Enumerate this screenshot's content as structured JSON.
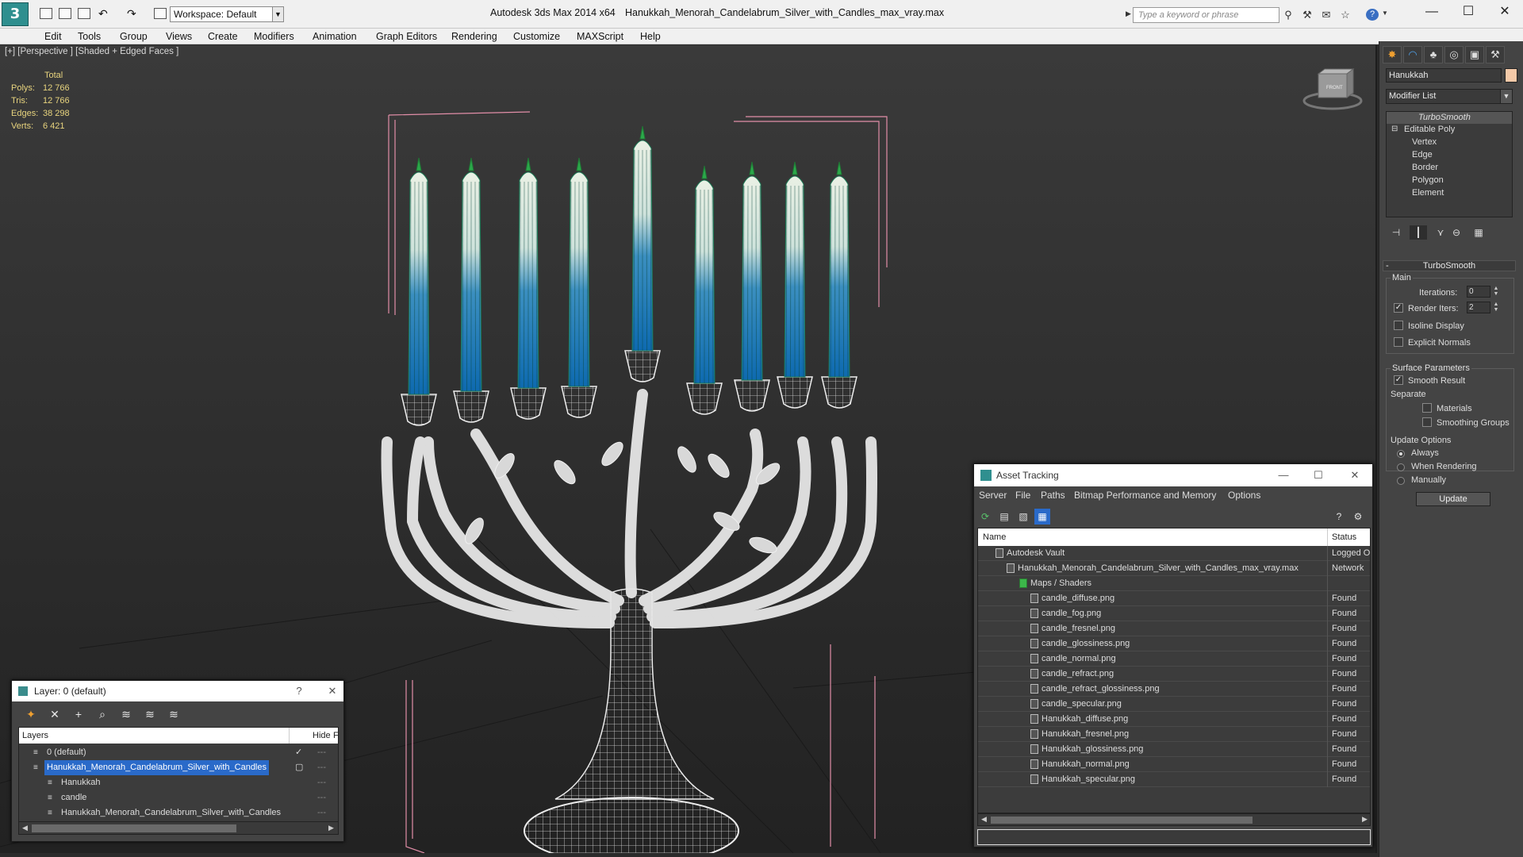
{
  "app": {
    "title": "Autodesk 3ds Max  2014 x64",
    "filename": "Hanukkah_Menorah_Candelabrum_Silver_with_Candles_max_vray.max",
    "workspace": "Workspace: Default",
    "search_placeholder": "Type a keyword or phrase",
    "logo_letter": "3"
  },
  "menu": [
    "Edit",
    "Tools",
    "Group",
    "Views",
    "Create",
    "Modifiers",
    "Animation",
    "Graph Editors",
    "Rendering",
    "Customize",
    "MAXScript",
    "Help"
  ],
  "viewport": {
    "label": "[+] [Perspective ] [Shaded + Edged Faces ]",
    "stats_header": "Total",
    "stats": [
      {
        "label": "Polys:",
        "value": "12 766"
      },
      {
        "label": "Tris:",
        "value": "12 766"
      },
      {
        "label": "Edges:",
        "value": "38 298"
      },
      {
        "label": "Verts:",
        "value": "6 421"
      }
    ],
    "viewcube_label": "FRONT"
  },
  "command_panel": {
    "object_name": "Hanukkah",
    "object_color": "#f3c9a8",
    "modifier_list": "Modifier List",
    "stack": {
      "top": "TurboSmooth",
      "base": "Editable Poly",
      "subs": [
        "Vertex",
        "Edge",
        "Border",
        "Polygon",
        "Element"
      ]
    },
    "turbosmooth": {
      "header": "TurboSmooth",
      "main_group": "Main",
      "iterations_label": "Iterations:",
      "iterations": "0",
      "render_iters_label": "Render Iters:",
      "render_iters": "2",
      "render_iters_checked": true,
      "isoline": "Isoline Display",
      "explicit_normals": "Explicit Normals",
      "surface_group": "Surface Parameters",
      "smooth_result": "Smooth Result",
      "smooth_result_checked": true,
      "separate_label": "Separate",
      "materials": "Materials",
      "smoothing_groups": "Smoothing Groups",
      "update_group": "Update Options",
      "always": "Always",
      "when_rendering": "When Rendering",
      "manually": "Manually",
      "update_button": "Update"
    }
  },
  "layer_dialog": {
    "title": "Layer: 0 (default)",
    "help": "?",
    "close": "✕",
    "col_layers": "Layers",
    "col_hide": "Hide",
    "col_extra": "F",
    "rows": [
      {
        "name": "0 (default)",
        "indent": 1,
        "selected": false,
        "check": "✓"
      },
      {
        "name": "Hanukkah_Menorah_Candelabrum_Silver_with_Candles",
        "indent": 1,
        "selected": true,
        "check": "▢"
      },
      {
        "name": "Hanukkah",
        "indent": 2,
        "selected": false,
        "check": ""
      },
      {
        "name": "candle",
        "indent": 2,
        "selected": false,
        "check": ""
      },
      {
        "name": "Hanukkah_Menorah_Candelabrum_Silver_with_Candles",
        "indent": 2,
        "selected": false,
        "check": ""
      }
    ]
  },
  "asset_dialog": {
    "title": "Asset Tracking",
    "menu": [
      "Server",
      "File",
      "Paths",
      "Bitmap Performance and Memory",
      "Options"
    ],
    "col_name": "Name",
    "col_status": "Status",
    "rows": [
      {
        "name": "Autodesk Vault",
        "status": "Logged O",
        "indent": 1
      },
      {
        "name": "Hanukkah_Menorah_Candelabrum_Silver_with_Candles_max_vray.max",
        "status": "Network",
        "indent": 2
      },
      {
        "name": "Maps / Shaders",
        "status": "",
        "indent": 3
      },
      {
        "name": "candle_diffuse.png",
        "status": "Found",
        "indent": 4
      },
      {
        "name": "candle_fog.png",
        "status": "Found",
        "indent": 4
      },
      {
        "name": "candle_fresnel.png",
        "status": "Found",
        "indent": 4
      },
      {
        "name": "candle_glossiness.png",
        "status": "Found",
        "indent": 4
      },
      {
        "name": "candle_normal.png",
        "status": "Found",
        "indent": 4
      },
      {
        "name": "candle_refract.png",
        "status": "Found",
        "indent": 4
      },
      {
        "name": "candle_refract_glossiness.png",
        "status": "Found",
        "indent": 4
      },
      {
        "name": "candle_specular.png",
        "status": "Found",
        "indent": 4
      },
      {
        "name": "Hanukkah_diffuse.png",
        "status": "Found",
        "indent": 4
      },
      {
        "name": "Hanukkah_fresnel.png",
        "status": "Found",
        "indent": 4
      },
      {
        "name": "Hanukkah_glossiness.png",
        "status": "Found",
        "indent": 4
      },
      {
        "name": "Hanukkah_normal.png",
        "status": "Found",
        "indent": 4
      },
      {
        "name": "Hanukkah_specular.png",
        "status": "Found",
        "indent": 4
      }
    ]
  }
}
